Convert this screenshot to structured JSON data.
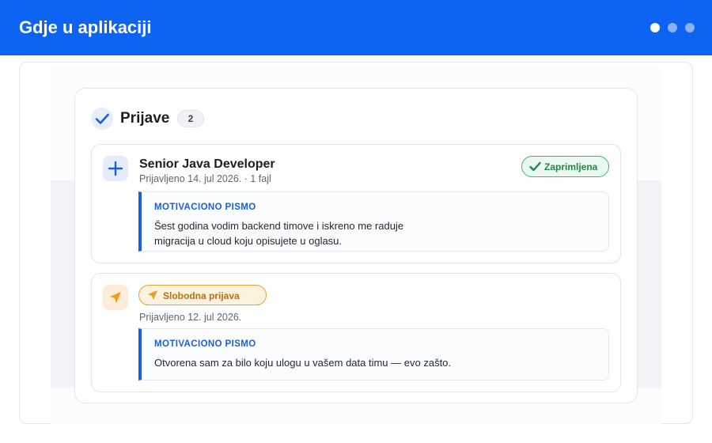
{
  "header": {
    "title": "Gdje u aplikaciji",
    "dots": 3,
    "accent": "#0d63f2"
  },
  "panel": {
    "title": "Prijave",
    "count": "2",
    "title_icon": "check-icon"
  },
  "applications": [
    {
      "icon": "plus-icon",
      "title": "Senior Java Developer",
      "meta": "Prijavljeno 14. jul 2026. · 1 fajl",
      "status": {
        "label": "Zaprimljena",
        "icon": "check-icon",
        "color": "#1f8a47"
      },
      "letter": {
        "label": "MOTIVACIONO PISMO",
        "lines": [
          "Šest godina vodim backend timove i iskreno me raduje",
          "migracija u cloud koju opisujete u oglasu."
        ]
      }
    },
    {
      "icon": "send-icon",
      "badge": {
        "label": "Slobodna prijava",
        "icon": "send-icon",
        "color": "#b9700f"
      },
      "meta": "Prijavljeno 12. jul 2026.",
      "letter": {
        "label": "MOTIVACIONO PISMO",
        "lines": [
          "Otvorena sam za bilo koju ulogu u vašem data timu — evo zašto."
        ]
      }
    }
  ]
}
